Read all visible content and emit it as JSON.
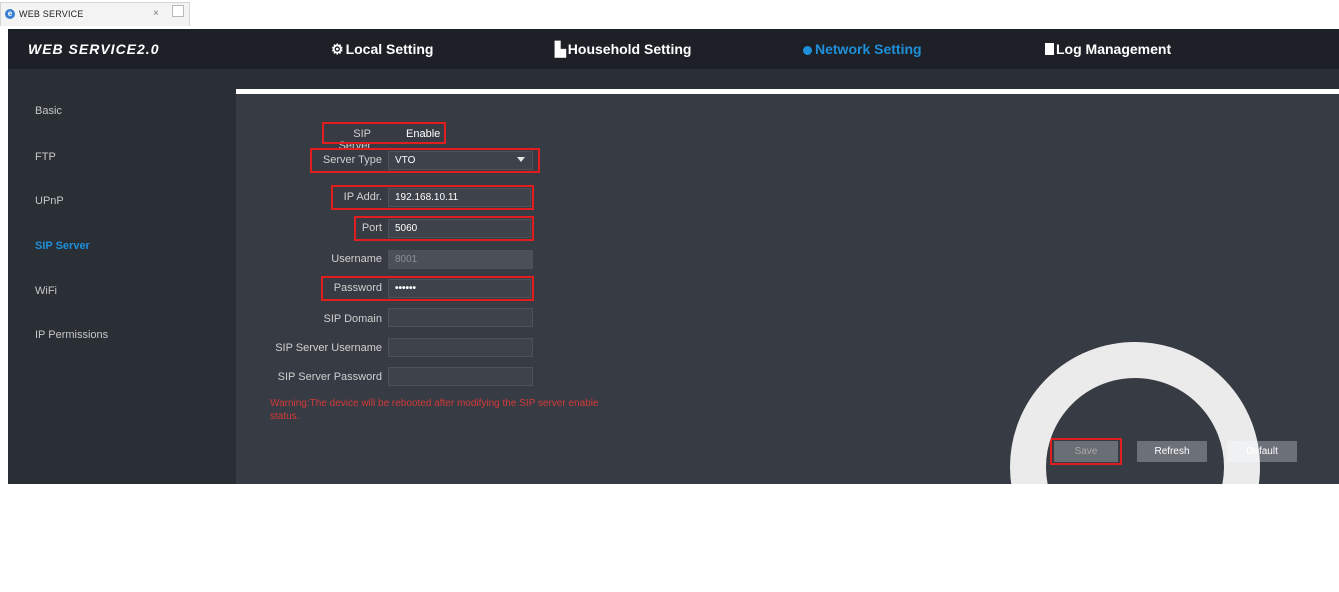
{
  "browser": {
    "tab_title": "WEB SERVICE",
    "tab_close": "×"
  },
  "header": {
    "logo": "WEB SERVICE2.0",
    "nav": [
      {
        "label": "Local Setting",
        "icon": "gear-icon",
        "glyph": "⚙"
      },
      {
        "label": "Household Setting",
        "icon": "building-icon",
        "glyph": "▙"
      },
      {
        "label": "Network Setting",
        "icon": "globe-icon",
        "active": true
      },
      {
        "label": "Log Management",
        "icon": "document-icon"
      }
    ]
  },
  "sidebar": {
    "items": [
      {
        "label": "Basic"
      },
      {
        "label": "FTP"
      },
      {
        "label": "UPnP"
      },
      {
        "label": "SIP Server",
        "active": true
      },
      {
        "label": "WiFi"
      },
      {
        "label": "IP Permissions"
      }
    ]
  },
  "form": {
    "sip_server": {
      "label": "SIP Server",
      "value": "Enable"
    },
    "server_type": {
      "label": "Server Type",
      "value": "VTO"
    },
    "ip_addr": {
      "label": "IP Addr.",
      "value": "192.168.10.11"
    },
    "port": {
      "label": "Port",
      "value": "5060"
    },
    "username": {
      "label": "Username",
      "value": "8001"
    },
    "password": {
      "label": "Password",
      "value": "••••••"
    },
    "sip_domain": {
      "label": "SIP Domain",
      "value": ""
    },
    "sip_server_username": {
      "label": "SIP Server Username",
      "value": ""
    },
    "sip_server_password": {
      "label": "SIP Server Password",
      "value": ""
    },
    "warning": "Warning:The device will be rebooted after modifying the SIP server enable status."
  },
  "buttons": {
    "save": "Save",
    "refresh": "Refresh",
    "default": "Default"
  },
  "colors": {
    "accent": "#1f8fd9",
    "highlight_box": "#e01e1e",
    "warning": "#d23a3a"
  }
}
